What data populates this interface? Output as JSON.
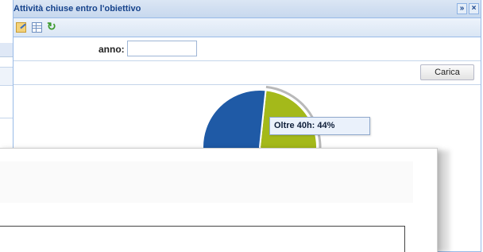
{
  "window": {
    "title": "Attività chiuse entro l'obiettivo",
    "tools": {
      "collapse_glyph": "»",
      "close_glyph": "×"
    }
  },
  "toolbar": {
    "icons": [
      "edit-icon",
      "table-icon",
      "refresh-icon"
    ]
  },
  "form": {
    "anno_label": "anno:",
    "anno_value": "",
    "anno_placeholder": ""
  },
  "actions": {
    "carica_label": "Carica"
  },
  "chart_data": {
    "type": "pie",
    "tooltip": "Oltre 40h: 44%",
    "slices": [
      {
        "label": "Oltre 40h",
        "percent": 44,
        "color": "#a4b91a"
      },
      {
        "label": "",
        "percent": 56,
        "color": "#1f5aa6"
      }
    ]
  },
  "colors": {
    "title_text": "#15428b",
    "border": "#99bbe8"
  }
}
